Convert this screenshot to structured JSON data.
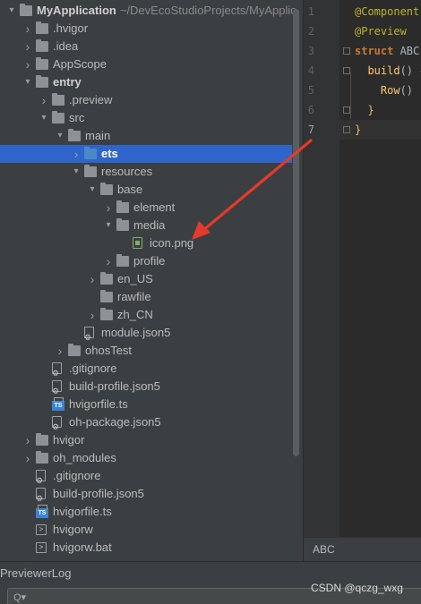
{
  "project": {
    "root_name": "MyApplication",
    "root_path": "~/DevEcoStudioProjects/MyApplic",
    "items": [
      {
        "label": "MyApplication",
        "indent": 0,
        "arrow": "open",
        "icon": "folder-module"
      },
      {
        "label": ".hvigor",
        "indent": 1,
        "arrow": "closed",
        "icon": "folder"
      },
      {
        "label": ".idea",
        "indent": 1,
        "arrow": "closed",
        "icon": "folder"
      },
      {
        "label": "AppScope",
        "indent": 1,
        "arrow": "closed",
        "icon": "folder"
      },
      {
        "label": "entry",
        "indent": 1,
        "arrow": "open",
        "icon": "folder-module"
      },
      {
        "label": ".preview",
        "indent": 2,
        "arrow": "closed",
        "icon": "folder"
      },
      {
        "label": "src",
        "indent": 2,
        "arrow": "open",
        "icon": "folder"
      },
      {
        "label": "main",
        "indent": 3,
        "arrow": "open",
        "icon": "folder"
      },
      {
        "label": "ets",
        "indent": 4,
        "arrow": "closed",
        "icon": "folder-blue"
      },
      {
        "label": "resources",
        "indent": 4,
        "arrow": "open",
        "icon": "folder"
      },
      {
        "label": "base",
        "indent": 5,
        "arrow": "open",
        "icon": "folder"
      },
      {
        "label": "element",
        "indent": 6,
        "arrow": "closed",
        "icon": "folder"
      },
      {
        "label": "media",
        "indent": 6,
        "arrow": "open",
        "icon": "folder"
      },
      {
        "label": "icon.png",
        "indent": 7,
        "arrow": "none",
        "icon": "image-file"
      },
      {
        "label": "profile",
        "indent": 6,
        "arrow": "closed",
        "icon": "folder"
      },
      {
        "label": "en_US",
        "indent": 5,
        "arrow": "closed",
        "icon": "folder"
      },
      {
        "label": "rawfile",
        "indent": 5,
        "arrow": "none",
        "icon": "folder"
      },
      {
        "label": "zh_CN",
        "indent": 5,
        "arrow": "closed",
        "icon": "folder"
      },
      {
        "label": "module.json5",
        "indent": 4,
        "arrow": "none",
        "icon": "config-file"
      },
      {
        "label": "ohosTest",
        "indent": 3,
        "arrow": "closed",
        "icon": "folder"
      },
      {
        "label": ".gitignore",
        "indent": 2,
        "arrow": "none",
        "icon": "config-file"
      },
      {
        "label": "build-profile.json5",
        "indent": 2,
        "arrow": "none",
        "icon": "config-file"
      },
      {
        "label": "hvigorfile.ts",
        "indent": 2,
        "arrow": "none",
        "icon": "ts-file"
      },
      {
        "label": "oh-package.json5",
        "indent": 2,
        "arrow": "none",
        "icon": "config-file"
      },
      {
        "label": "hvigor",
        "indent": 1,
        "arrow": "closed",
        "icon": "folder"
      },
      {
        "label": "oh_modules",
        "indent": 1,
        "arrow": "closed",
        "icon": "folder"
      },
      {
        "label": ".gitignore",
        "indent": 1,
        "arrow": "none",
        "icon": "config-file"
      },
      {
        "label": "build-profile.json5",
        "indent": 1,
        "arrow": "none",
        "icon": "config-file"
      },
      {
        "label": "hvigorfile.ts",
        "indent": 1,
        "arrow": "none",
        "icon": "ts-file"
      },
      {
        "label": "hvigorw",
        "indent": 1,
        "arrow": "none",
        "icon": "terminal-file"
      },
      {
        "label": "hvigorw.bat",
        "indent": 1,
        "arrow": "none",
        "icon": "terminal-file"
      }
    ],
    "selected_index": 8
  },
  "editor": {
    "lines": [
      {
        "num": "1",
        "tokens": [
          {
            "t": "@Component",
            "c": "anno"
          }
        ]
      },
      {
        "num": "2",
        "tokens": [
          {
            "t": "@Preview",
            "c": "anno"
          }
        ]
      },
      {
        "num": "3",
        "tokens": [
          {
            "t": "struct ",
            "c": "kw"
          },
          {
            "t": "ABC",
            "c": "plain"
          }
        ]
      },
      {
        "num": "4",
        "tokens": [
          {
            "t": "  build",
            "c": "fn"
          },
          {
            "t": "() {",
            "c": "plain"
          }
        ]
      },
      {
        "num": "5",
        "tokens": [
          {
            "t": "    Row",
            "c": "fn"
          },
          {
            "t": "()",
            "c": "plain"
          }
        ]
      },
      {
        "num": "6",
        "tokens": [
          {
            "t": "  }",
            "c": "gold"
          }
        ]
      },
      {
        "num": "7",
        "tokens": [
          {
            "t": "}",
            "c": "gold"
          }
        ]
      }
    ],
    "current_line": 7,
    "tab_label": "ABC"
  },
  "bottom_panel": {
    "title": "PreviewerLog",
    "search_placeholder": ""
  },
  "watermark": "CSDN @qczg_wxg",
  "colors": {
    "selection": "#2f65ca",
    "annotation_arrow": "#e53a2b",
    "folder_source": "#4a88c7"
  }
}
